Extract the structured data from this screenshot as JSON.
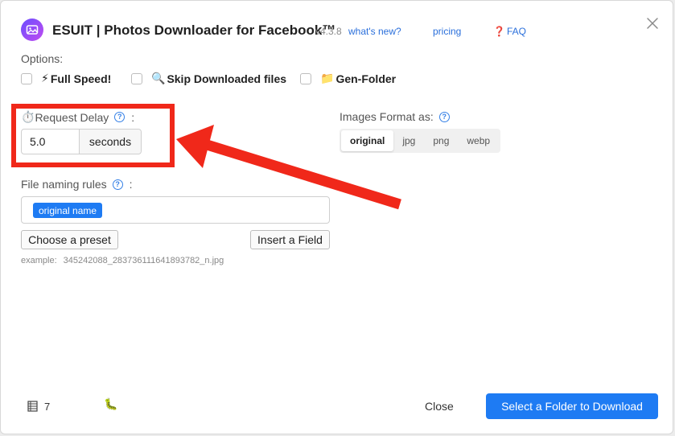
{
  "header": {
    "title": "ESUIT | Photos Downloader for Facebook™",
    "version": "v4.3.8",
    "whats_new": "what's new?",
    "pricing": "pricing",
    "faq_mark": "❓",
    "faq": "FAQ"
  },
  "options": {
    "label": "Options:",
    "items": [
      {
        "emoji": "⚡",
        "label": "Full Speed!",
        "checked": false
      },
      {
        "emoji": "🔍",
        "label": "Skip Downloaded files",
        "checked": false
      },
      {
        "emoji": "📁",
        "label": "Gen-Folder",
        "checked": false
      }
    ]
  },
  "request_delay": {
    "emoji": "⏱️",
    "label": "Request Delay",
    "help": "?",
    "colon": ":",
    "value": "5.0",
    "unit": "seconds"
  },
  "images_format": {
    "label": "Images Format as:",
    "help": "?",
    "options": [
      "original",
      "jpg",
      "png",
      "webp"
    ],
    "selected": "original"
  },
  "naming": {
    "label": "File naming rules",
    "help": "?",
    "colon": ":",
    "tag": "original name",
    "preset_button": "Choose a preset",
    "insert_button": "Insert a Field",
    "example_label": "example:",
    "example_value": "345242088_283736111641893782_n.jpg"
  },
  "footer": {
    "count": "7",
    "bug_emoji": "🐛",
    "close": "Close",
    "primary": "Select a Folder to Download"
  },
  "colors": {
    "accent": "#1e7bf3",
    "highlight": "#f0281a",
    "link": "#2a6fdb"
  }
}
